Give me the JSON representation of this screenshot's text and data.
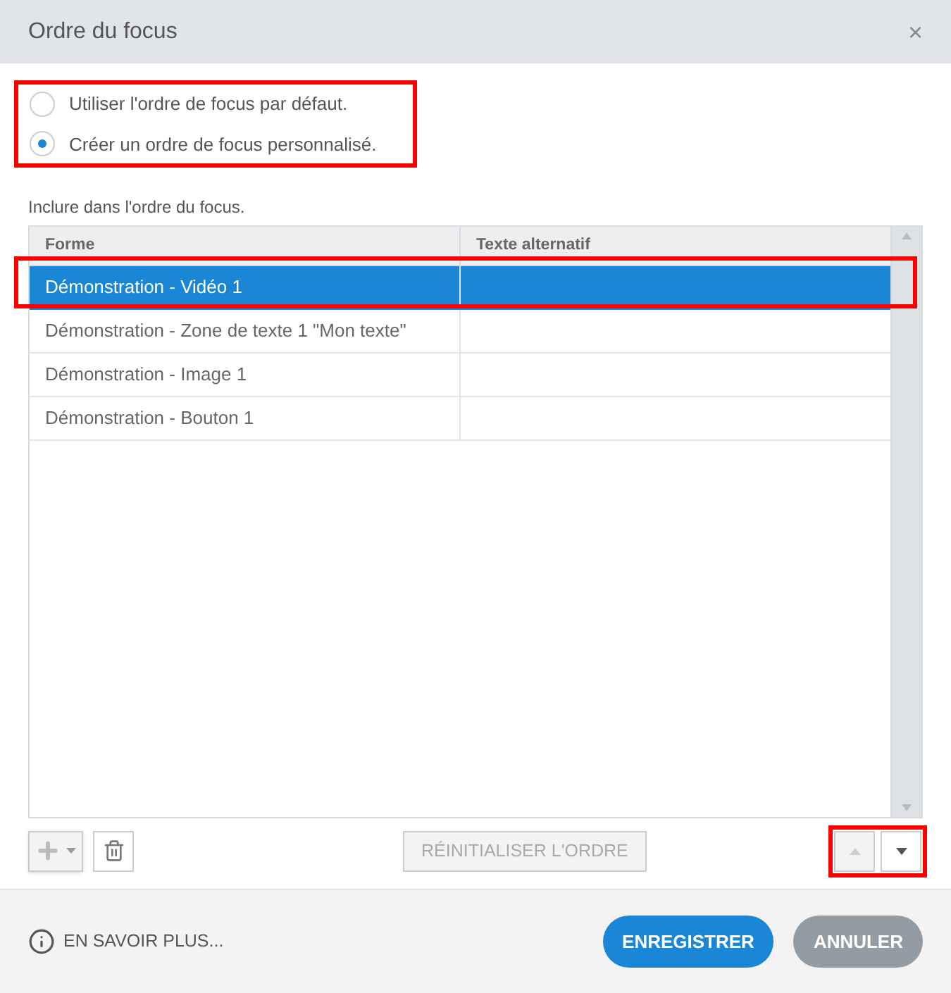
{
  "window": {
    "title": "Ordre du focus",
    "close": "×"
  },
  "options": [
    {
      "label": "Utiliser l'ordre de focus par défaut.",
      "selected": false
    },
    {
      "label": "Créer un ordre de focus personnalisé.",
      "selected": true
    }
  ],
  "include_label": "Inclure dans l'ordre du focus.",
  "table": {
    "columns": [
      "Forme",
      "Texte alternatif"
    ],
    "rows": [
      {
        "shape": "Démonstration - Vidéo 1",
        "selected": true
      },
      {
        "shape": "Démonstration - Zone de texte 1 \"Mon texte\"",
        "selected": false
      },
      {
        "shape": "Démonstration - Image 1",
        "selected": false
      },
      {
        "shape": "Démonstration - Bouton 1",
        "selected": false
      }
    ]
  },
  "toolbar": {
    "reset": {
      "label": "RÉINITIALISER L'ORDRE",
      "disabled": true
    },
    "move_up": {
      "disabled": true
    },
    "move_down": {
      "disabled": false
    }
  },
  "footer": {
    "learn_more": "EN SAVOIR PLUS...",
    "save": "ENREGISTRER",
    "cancel": "ANNULER"
  }
}
